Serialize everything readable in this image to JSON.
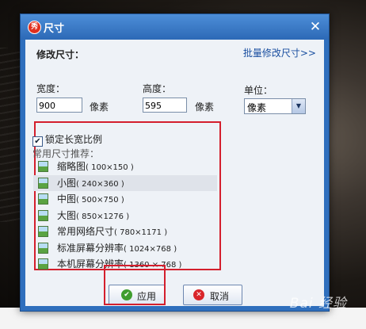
{
  "dialog": {
    "title": "尺寸",
    "section_title": "修改尺寸：",
    "batch_link": "批量修改尺寸>>",
    "width_label": "宽度：",
    "width_value": "900",
    "height_label": "高度：",
    "height_value": "595",
    "pixel_unit_1": "像素",
    "pixel_unit_2": "像素",
    "unit_label": "单位：",
    "unit_selected": "像素",
    "lock_label": "锁定长宽比例",
    "lock_checked": true,
    "common_label": "常用尺寸推荐：",
    "presets": [
      {
        "name": "缩略图",
        "dim": "( 100×150 )"
      },
      {
        "name": "小图",
        "dim": "( 240×360 )"
      },
      {
        "name": "中图",
        "dim": "( 500×750 )"
      },
      {
        "name": "大图",
        "dim": "( 850×1276 )"
      },
      {
        "name": "常用网络尺寸",
        "dim": "( 780×1171 )"
      },
      {
        "name": "标准屏幕分辨率",
        "dim": "( 1024×768 )"
      },
      {
        "name": "本机屏幕分辨率",
        "dim": "( 1360 × 768 )"
      }
    ],
    "ok_label": "应用",
    "cancel_label": "取消"
  },
  "watermark": "Bai 经验",
  "colors": {
    "title_blue": "#2f6fbd",
    "highlight_red": "#d41f2d",
    "link_blue": "#1a4fa0"
  }
}
